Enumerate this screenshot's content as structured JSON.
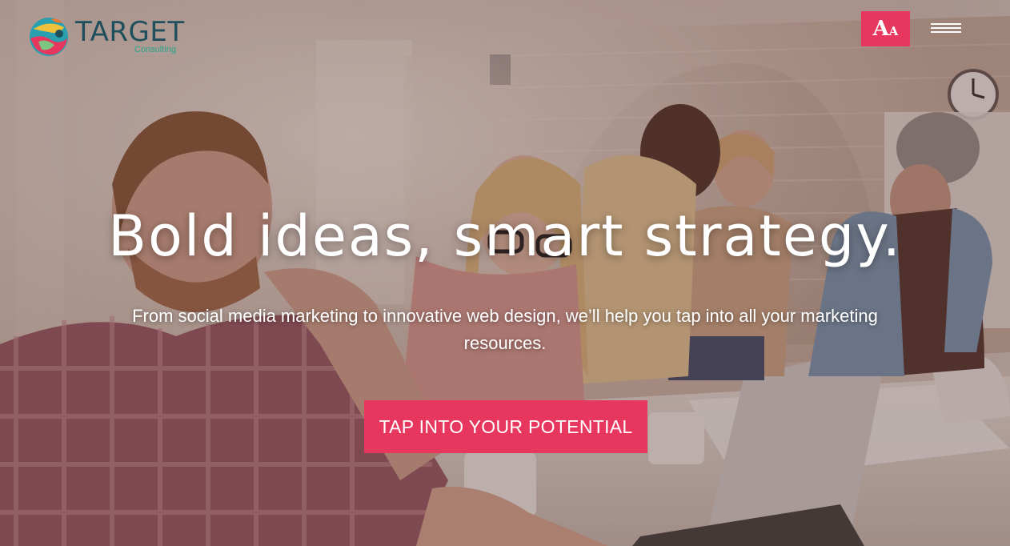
{
  "brand": {
    "name": "TARGET",
    "tagline": "Consulting"
  },
  "header": {
    "accessibility_big": "A",
    "accessibility_small": "A",
    "menu_icon": "hamburger-icon"
  },
  "hero": {
    "headline": "Bold ideas, smart strategy.",
    "subheadline": "From social media marketing to innovative web design, we’ll help you tap into all your marketing resources.",
    "cta_label": "TAP INTO YOUR POTENTIAL"
  },
  "colors": {
    "accent": "#e8375e",
    "brand_text": "#1f4f5c",
    "brand_sub": "#27a58a",
    "text": "#ffffff"
  }
}
